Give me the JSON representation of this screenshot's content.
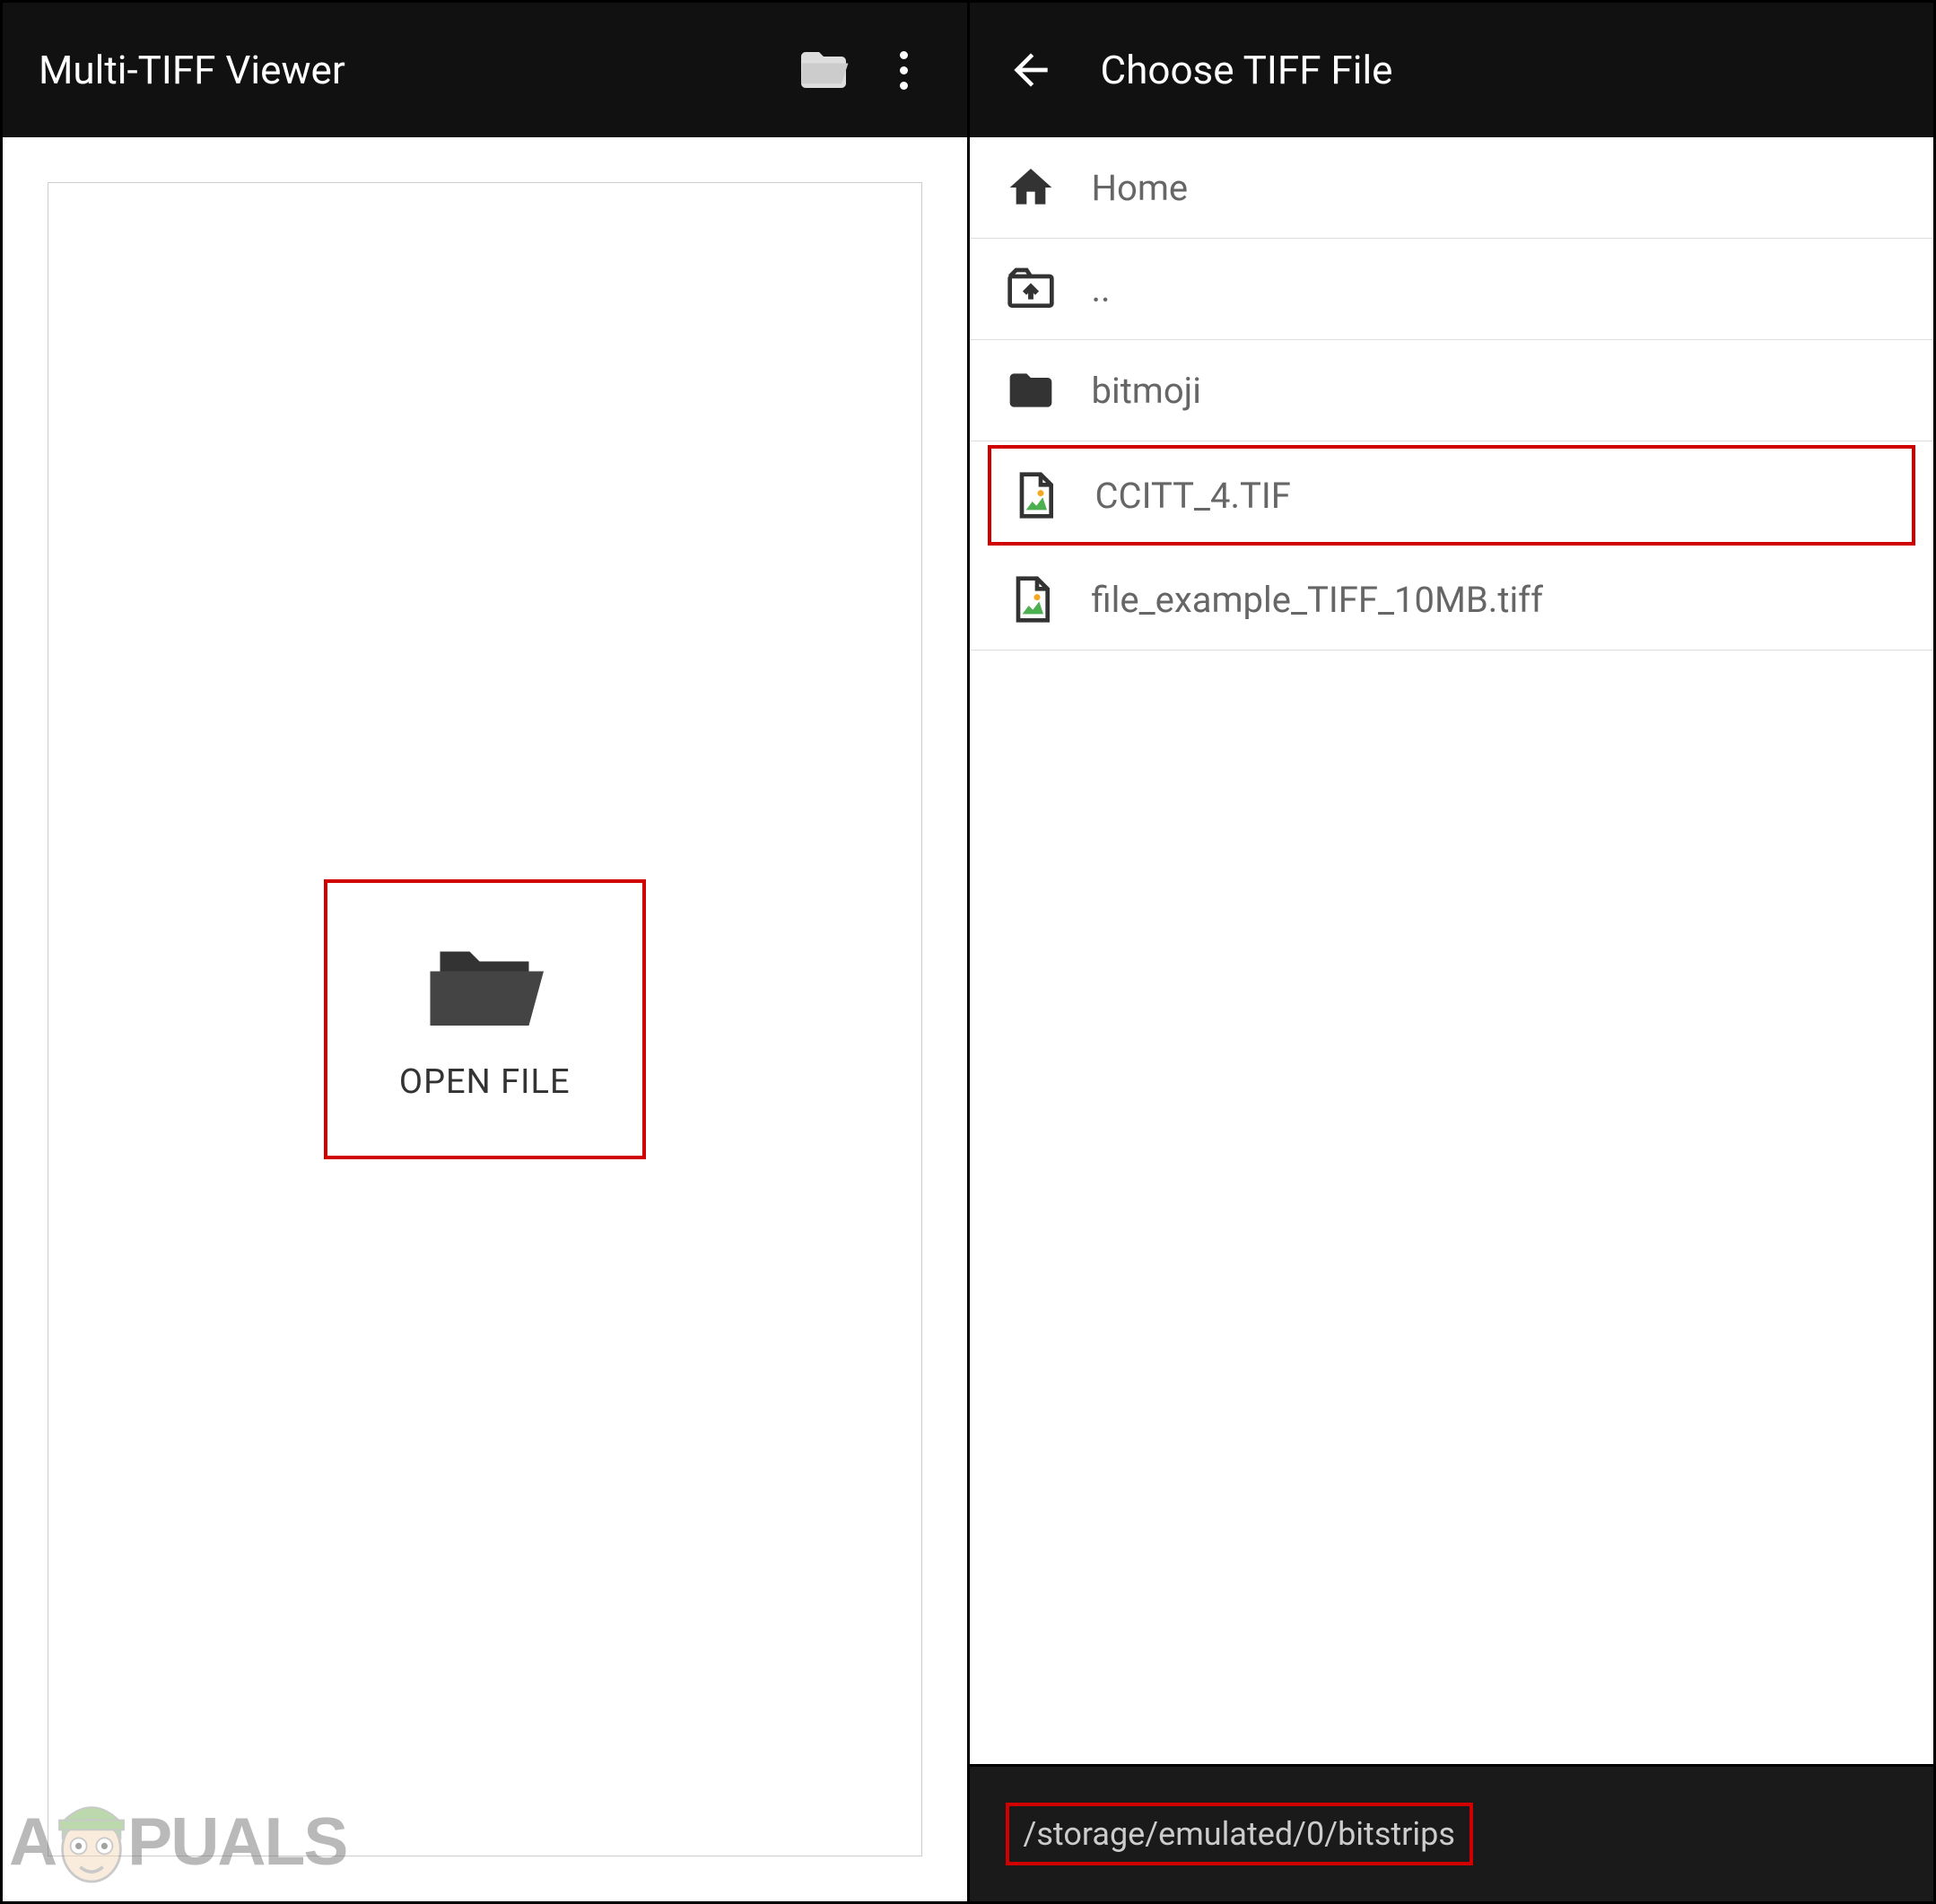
{
  "left": {
    "title": "Multi-TIFF Viewer",
    "open_file_label": "OPEN FILE"
  },
  "right": {
    "title": "Choose TIFF File",
    "items": [
      {
        "icon": "home",
        "label": "Home"
      },
      {
        "icon": "folder-up",
        "label": ".."
      },
      {
        "icon": "folder",
        "label": "bitmoji"
      },
      {
        "icon": "image-file",
        "label": "CCITT_4.TIF",
        "highlighted": true
      },
      {
        "icon": "image-file",
        "label": "file_example_TIFF_10MB.tiff"
      }
    ],
    "path": "/storage/emulated/0/bitstrips"
  },
  "watermark": {
    "prefix": "A",
    "suffix": "PUALS"
  }
}
